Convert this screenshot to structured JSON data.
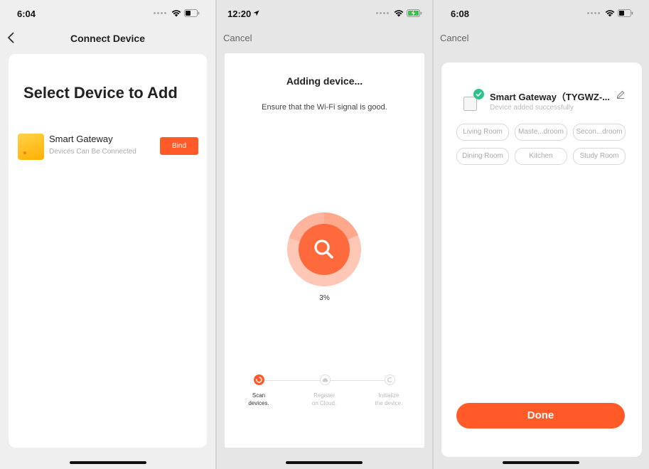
{
  "screen1": {
    "status_time": "6:04",
    "nav_title": "Connect Device",
    "heading": "Select Device to Add",
    "device": {
      "name": "Smart Gateway",
      "subtitle": "Devices Can Be Connected",
      "bind_label": "Bind"
    }
  },
  "screen2": {
    "status_time": "12:20",
    "cancel_label": "Cancel",
    "title": "Adding device...",
    "hint": "Ensure that the Wi-Fi signal is good.",
    "progress_text": "3%",
    "progress_value": 0.03,
    "steps": [
      {
        "label": "Scan\ndevices.",
        "state": "active"
      },
      {
        "label": "Register\non Cloud.",
        "state": "inactive"
      },
      {
        "label": "Initialize\nthe device.",
        "state": "inactive"
      }
    ]
  },
  "screen3": {
    "status_time": "6:08",
    "cancel_label": "Cancel",
    "device_name": "Smart Gateway（TYGWZ-...",
    "device_status": "Device added successfully",
    "rooms": [
      "Living Room",
      "Maste...droom",
      "Secon...droom",
      "Dining Room",
      "Kitchen",
      "Study Room"
    ],
    "done_label": "Done"
  },
  "colors": {
    "accent": "#ff5a28",
    "success": "#2ec28b",
    "device_icon": "#ffc21a"
  }
}
